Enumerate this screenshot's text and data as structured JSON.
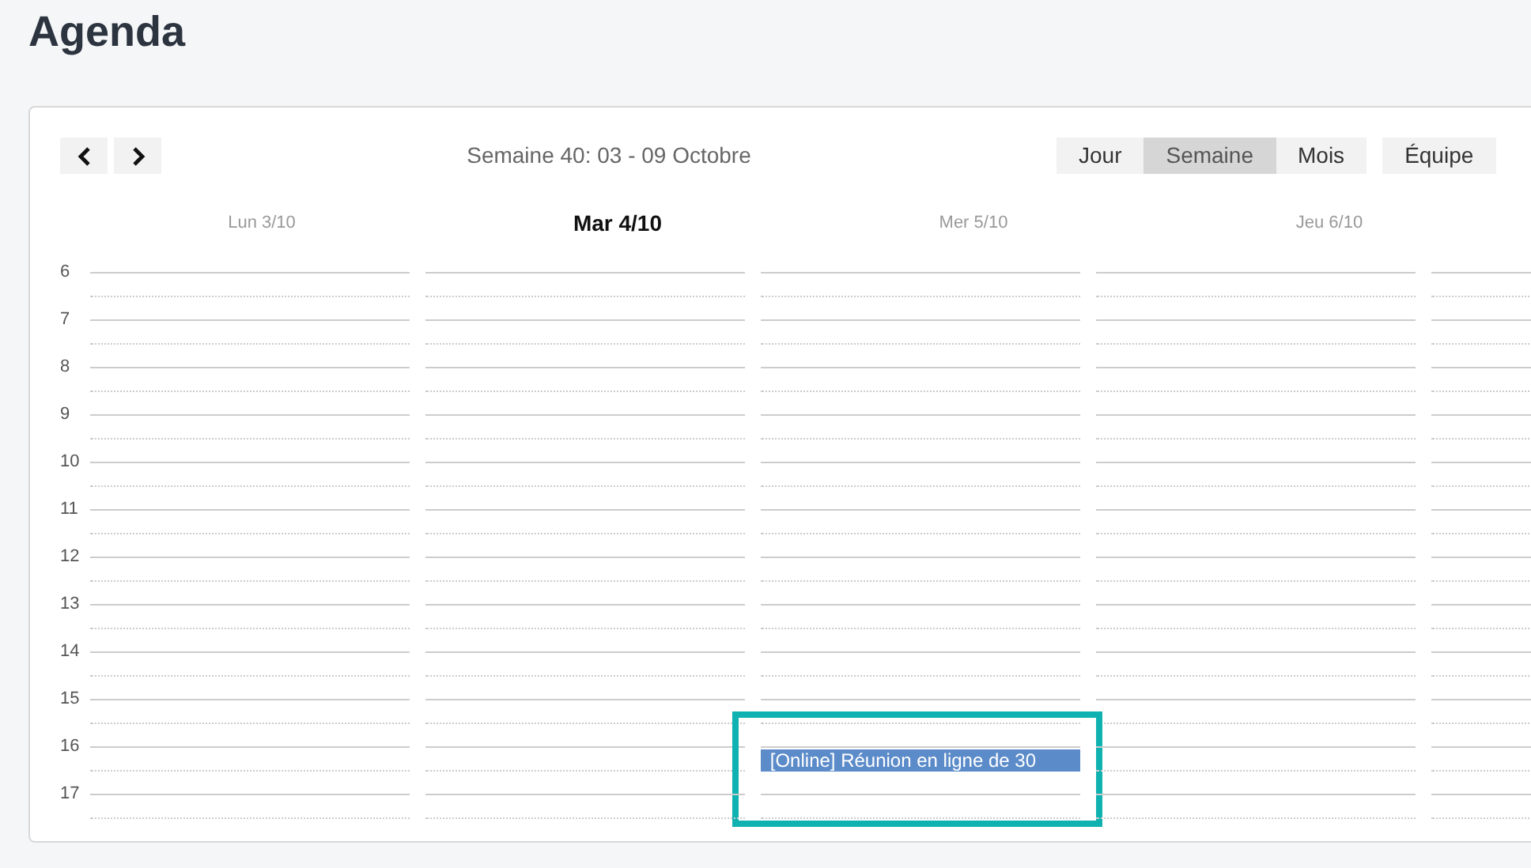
{
  "page_title": "Agenda",
  "navigation": {
    "previous": {
      "kind": "previous"
    },
    "next": {
      "kind": "next"
    }
  },
  "period_title": "Semaine 40: 03 - 09 Octobre",
  "views": [
    {
      "label": "Jour",
      "selected": false
    },
    {
      "label": "Semaine",
      "selected": true
    },
    {
      "label": "Mois",
      "selected": false
    }
  ],
  "team_button": "Équipe",
  "days": [
    {
      "label": "Lun 3/10",
      "today": false
    },
    {
      "label": "Mar 4/10",
      "today": true
    },
    {
      "label": "Mer 5/10",
      "today": false
    },
    {
      "label": "Jeu 6/10",
      "today": false
    }
  ],
  "hours": [
    {
      "label": "6"
    },
    {
      "label": "7"
    },
    {
      "label": "8"
    },
    {
      "label": "9"
    },
    {
      "label": "10"
    },
    {
      "label": "11"
    },
    {
      "label": "12"
    },
    {
      "label": "13"
    },
    {
      "label": "14"
    },
    {
      "label": "15"
    },
    {
      "label": "16",
      "cells": [
        {
          "kind": "empty"
        },
        {
          "kind": "empty"
        },
        {
          "kind": "event",
          "title": "[Online] Réunion en ligne de 30",
          "highlighted": true
        },
        {
          "kind": "empty"
        }
      ]
    },
    {
      "label": "17"
    }
  ]
}
